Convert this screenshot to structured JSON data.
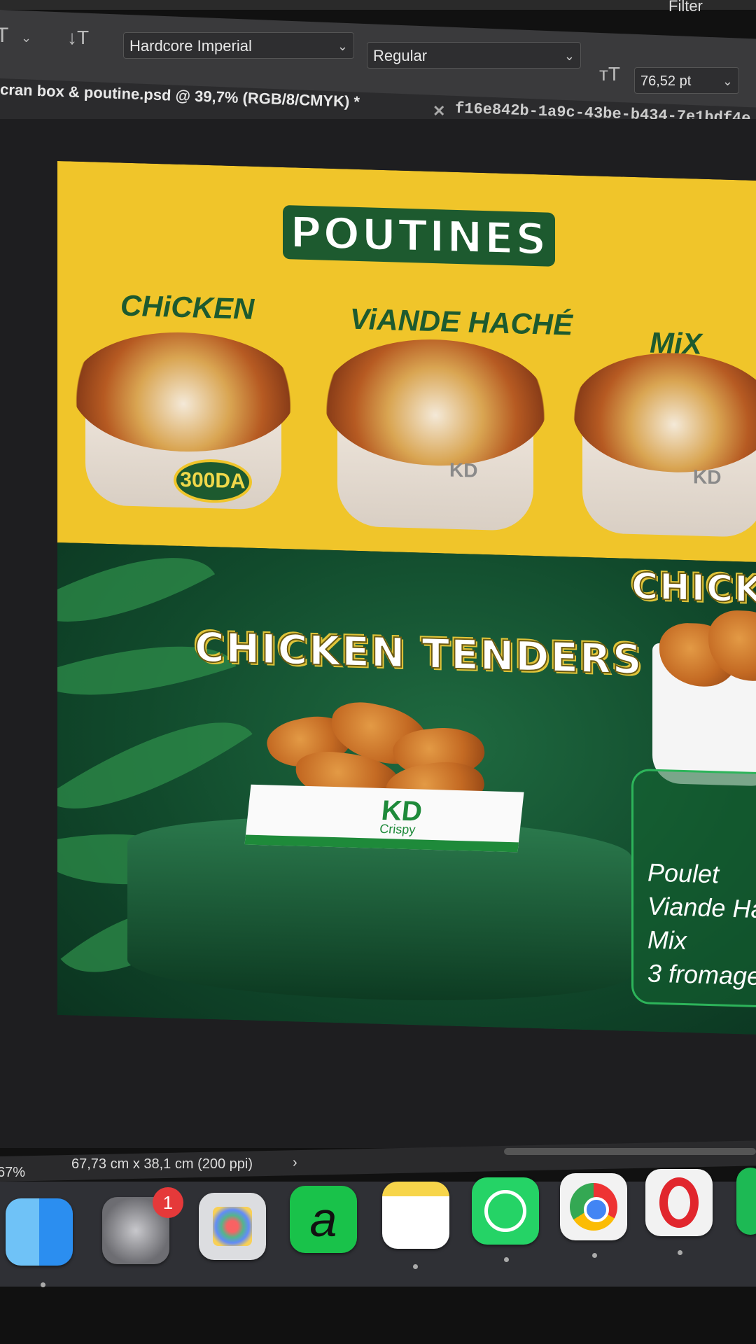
{
  "menubar": {
    "items": [
      "Filter"
    ]
  },
  "options": {
    "font_family": "Hardcore Imperial",
    "font_style": "Regular",
    "font_size": "76,52 pt"
  },
  "tabs": [
    {
      "label": "cran box & poutine.psd @ 39,7% (RGB/8/CMYK) *"
    },
    {
      "label": "f16e842b-1a9c-43be-b434-7e1bdf4e"
    }
  ],
  "poster": {
    "top_title": "POUTINES",
    "items": [
      {
        "label": "CHiCKEN"
      },
      {
        "label": "ViANDE HACHÉ"
      },
      {
        "label": "MiX"
      }
    ],
    "price": "300DA",
    "brand": "KD",
    "brand_sub": "Crispy",
    "section_title": "CHICKEN TENDERS",
    "right_title": "CHICKE",
    "right_menu": [
      "Poulet",
      "Viande Ha",
      "Mix",
      "3 fromage"
    ]
  },
  "status": {
    "zoom": "67%",
    "doc_size": "67,73 cm x 38,1 cm (200 ppi)"
  },
  "dock": {
    "apps": [
      {
        "name": "Finder",
        "icon": "finder-icon"
      },
      {
        "name": "System Settings",
        "icon": "settings-icon",
        "badge": "1"
      },
      {
        "name": "Launchpad",
        "icon": "launchpad-icon"
      },
      {
        "name": "Airtime",
        "icon": "airtime-icon"
      },
      {
        "name": "Notes",
        "icon": "notes-icon"
      },
      {
        "name": "WhatsApp",
        "icon": "whatsapp-icon"
      },
      {
        "name": "Chrome",
        "icon": "chrome-icon"
      },
      {
        "name": "Opera",
        "icon": "opera-icon"
      }
    ]
  }
}
